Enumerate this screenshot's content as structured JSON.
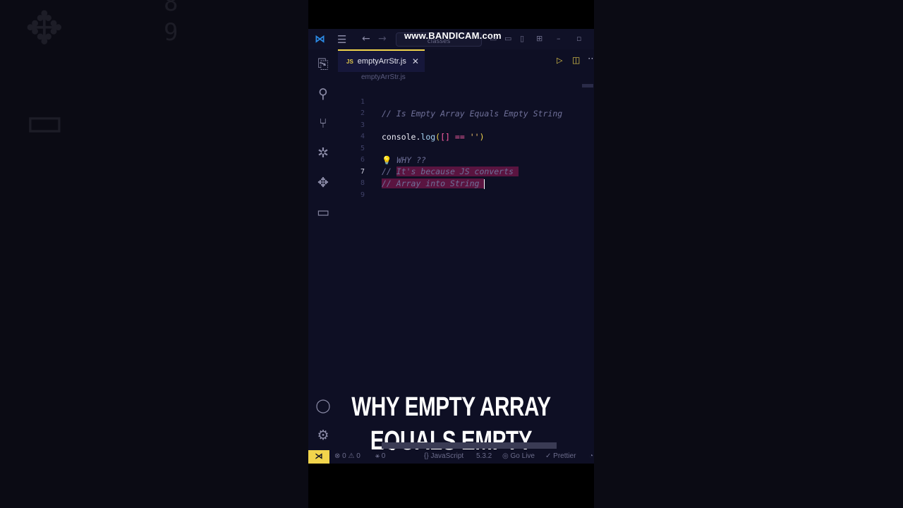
{
  "watermark": "www.BANDICAM.com",
  "titlebar": {
    "search_placeholder": "classes"
  },
  "tab": {
    "icon_label": "JS",
    "filename": "emptyArrStr.js"
  },
  "breadcrumb": "emptyArrStr.js",
  "editor": {
    "active_line": 7,
    "lines": [
      {
        "num": "1",
        "text": "// Is Empty Array Equals Empty String"
      },
      {
        "num": "2",
        "text": ""
      },
      {
        "num": "3",
        "text": "console.log([] == '')"
      },
      {
        "num": "4",
        "text": ""
      },
      {
        "num": "5",
        "text": "WHY ??"
      },
      {
        "num": "6",
        "text": "// It's because JS converts"
      },
      {
        "num": "7",
        "text": "// Array into String"
      },
      {
        "num": "8",
        "text": ""
      },
      {
        "num": "9",
        "text": ""
      }
    ],
    "code_parts": {
      "l3_obj": "console.",
      "l3_fn": "log",
      "l3_open": "(",
      "l3_arr": "[]",
      "l3_op": "==",
      "l3_str": "''",
      "l3_close": ")",
      "l6_prefix": "// ",
      "l6_hl": "It's because JS converts ",
      "l7_hl": "// Array into String ",
      "l5_text": "WHY ??"
    }
  },
  "overlay": {
    "line1": "WHY EMPTY ARRAY",
    "line2": "EQUALS EMPTY STRING"
  },
  "statusbar": {
    "errors": "0",
    "warnings": "0",
    "ports": "0",
    "language": "JavaScript",
    "version": "5.3.2",
    "golive": "Go Live",
    "prettier": "Prettier"
  },
  "background": {
    "ghost_number": "9",
    "ghost_number_top": "8"
  },
  "colors": {
    "accent": "#f1d44c",
    "editor_bg": "#0e0f24",
    "highlight": "#5a1440"
  }
}
